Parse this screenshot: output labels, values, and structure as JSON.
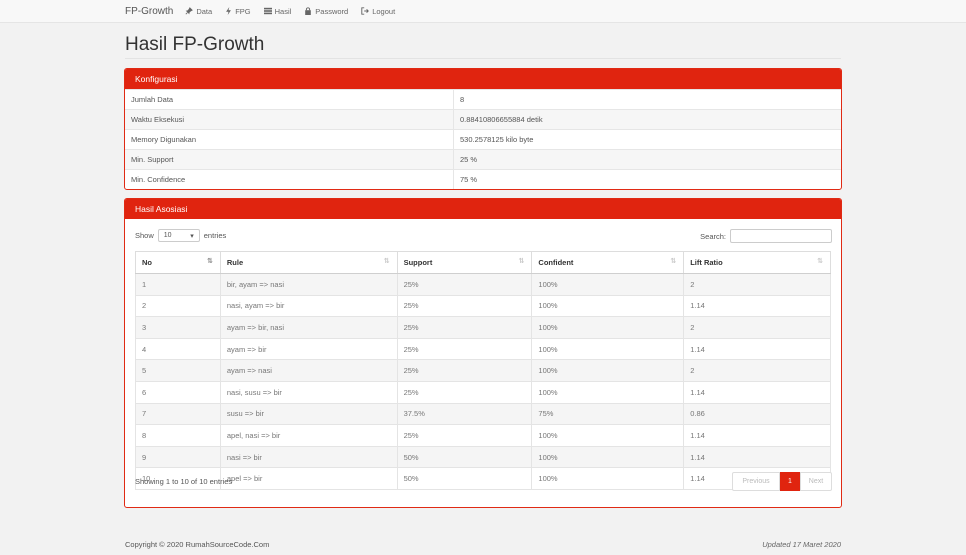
{
  "navbar": {
    "brand": "FP-Growth",
    "links": [
      "Data",
      "FPG",
      "Hasil",
      "Password",
      "Logout"
    ]
  },
  "page_title": "Hasil FP-Growth",
  "config": {
    "heading": "Konfigurasi",
    "rows": [
      {
        "label": "Jumlah Data",
        "value": "8"
      },
      {
        "label": "Waktu Eksekusi",
        "value": "0.88410806655884 detik"
      },
      {
        "label": "Memory Digunakan",
        "value": "530.2578125 kilo byte"
      },
      {
        "label": "Min. Support",
        "value": "25 %"
      },
      {
        "label": "Min. Confidence",
        "value": "75 %"
      }
    ]
  },
  "assoc": {
    "heading": "Hasil Asosiasi",
    "show_label": "Show",
    "entries_value": "10",
    "entries_label": "entries",
    "search_label": "Search:",
    "columns": [
      "No",
      "Rule",
      "Support",
      "Confident",
      "Lift Ratio"
    ],
    "rows": [
      [
        "1",
        "bir, ayam => nasi",
        "25%",
        "100%",
        "2"
      ],
      [
        "2",
        "nasi, ayam => bir",
        "25%",
        "100%",
        "1.14"
      ],
      [
        "3",
        "ayam => bir, nasi",
        "25%",
        "100%",
        "2"
      ],
      [
        "4",
        "ayam => bir",
        "25%",
        "100%",
        "1.14"
      ],
      [
        "5",
        "ayam => nasi",
        "25%",
        "100%",
        "2"
      ],
      [
        "6",
        "nasi, susu => bir",
        "25%",
        "100%",
        "1.14"
      ],
      [
        "7",
        "susu => bir",
        "37.5%",
        "75%",
        "0.86"
      ],
      [
        "8",
        "apel, nasi => bir",
        "25%",
        "100%",
        "1.14"
      ],
      [
        "9",
        "nasi => bir",
        "50%",
        "100%",
        "1.14"
      ],
      [
        "10",
        "apel => bir",
        "50%",
        "100%",
        "1.14"
      ]
    ],
    "info": "Showing 1 to 10 of 10 entries",
    "pagination": {
      "previous": "Previous",
      "current": "1",
      "next": "Next"
    }
  },
  "footer": {
    "copyright": "Copyright © 2020 RumahSourceCode.Com",
    "updated": "Updated 17 Maret 2020"
  },
  "colors": {
    "accent": "#e0240f"
  }
}
